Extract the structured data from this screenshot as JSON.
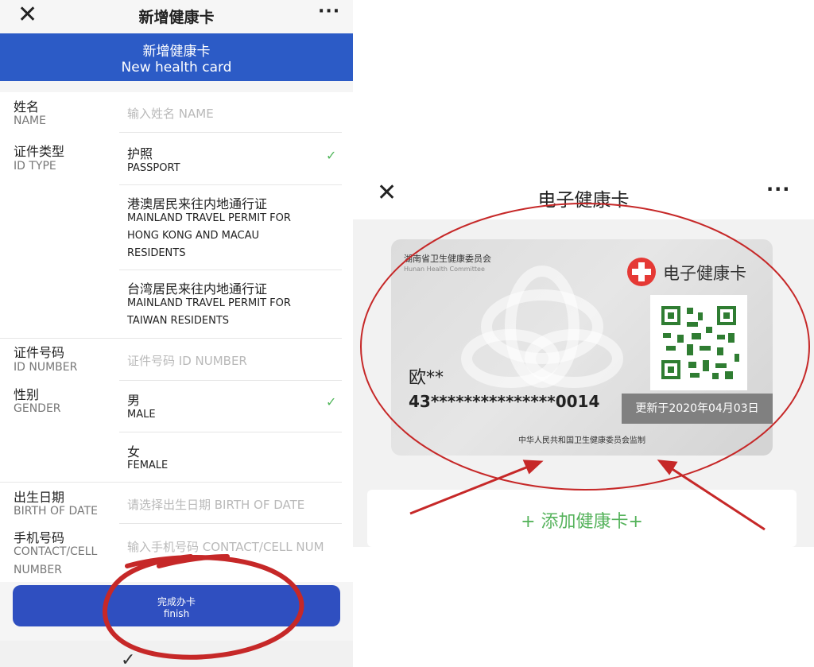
{
  "left_screen": {
    "topbar": {
      "close": "✕",
      "title": "新增健康卡",
      "more": "···"
    },
    "header": {
      "title_zh": "新增健康卡",
      "title_en": "New health card"
    },
    "form": {
      "name": {
        "label_zh": "姓名",
        "label_en": "NAME",
        "placeholder": "输入姓名 NAME"
      },
      "id_type": {
        "label_zh": "证件类型",
        "label_en": "ID TYPE",
        "options": [
          {
            "zh": "护照",
            "en_lines": [
              "PASSPORT"
            ],
            "selected": true
          },
          {
            "zh": "港澳居民来往内地通行证",
            "en_lines": [
              "MAINLAND TRAVEL PERMIT FOR",
              "HONG KONG AND MACAU",
              "RESIDENTS"
            ],
            "selected": false
          },
          {
            "zh": "台湾居民来往内地通行证",
            "en_lines": [
              "MAINLAND TRAVEL PERMIT FOR",
              "TAIWAN RESIDENTS"
            ],
            "selected": false
          }
        ]
      },
      "id_number": {
        "label_zh": "证件号码",
        "label_en": "ID NUMBER",
        "placeholder": "证件号码 ID NUMBER"
      },
      "gender": {
        "label_zh": "性别",
        "label_en": "GENDER",
        "options": [
          {
            "zh": "男",
            "en": "MALE",
            "selected": true
          },
          {
            "zh": "女",
            "en": "FEMALE",
            "selected": false
          }
        ]
      },
      "birth": {
        "label_zh": "出生日期",
        "label_en": "BIRTH OF DATE",
        "placeholder": "请选择出生日期 BIRTH OF DATE"
      },
      "contact": {
        "label_zh": "手机号码",
        "label_en_1": "CONTACT/CELL",
        "label_en_2": "NUMBER",
        "placeholder": "输入手机号码 CONTACT/CELL NUM"
      },
      "check_glyph": "✓"
    },
    "finish_button": {
      "zh": "完成办卡",
      "en": "finish"
    },
    "bottom_glyph": "✓"
  },
  "right_screen": {
    "topbar": {
      "close": "✕",
      "title": "电子健康卡",
      "more": "···"
    },
    "card": {
      "issuer_zh": "湖南省卫生健康委员会",
      "issuer_en": "Hunan Health Committee",
      "title": "电子健康卡",
      "owner_name": "欧**",
      "id_number": "43***************0014",
      "updated": "更新于2020年04月03日",
      "supervision": "中华人民共和国卫生健康委员会监制"
    },
    "add_card": "+ 添加健康卡+"
  },
  "colors": {
    "brand_blue": "#2c5bc6",
    "button_blue": "#2f4fc0",
    "check_green": "#52b75c",
    "annotation_red": "#c62828",
    "cross_red": "#e53935"
  }
}
